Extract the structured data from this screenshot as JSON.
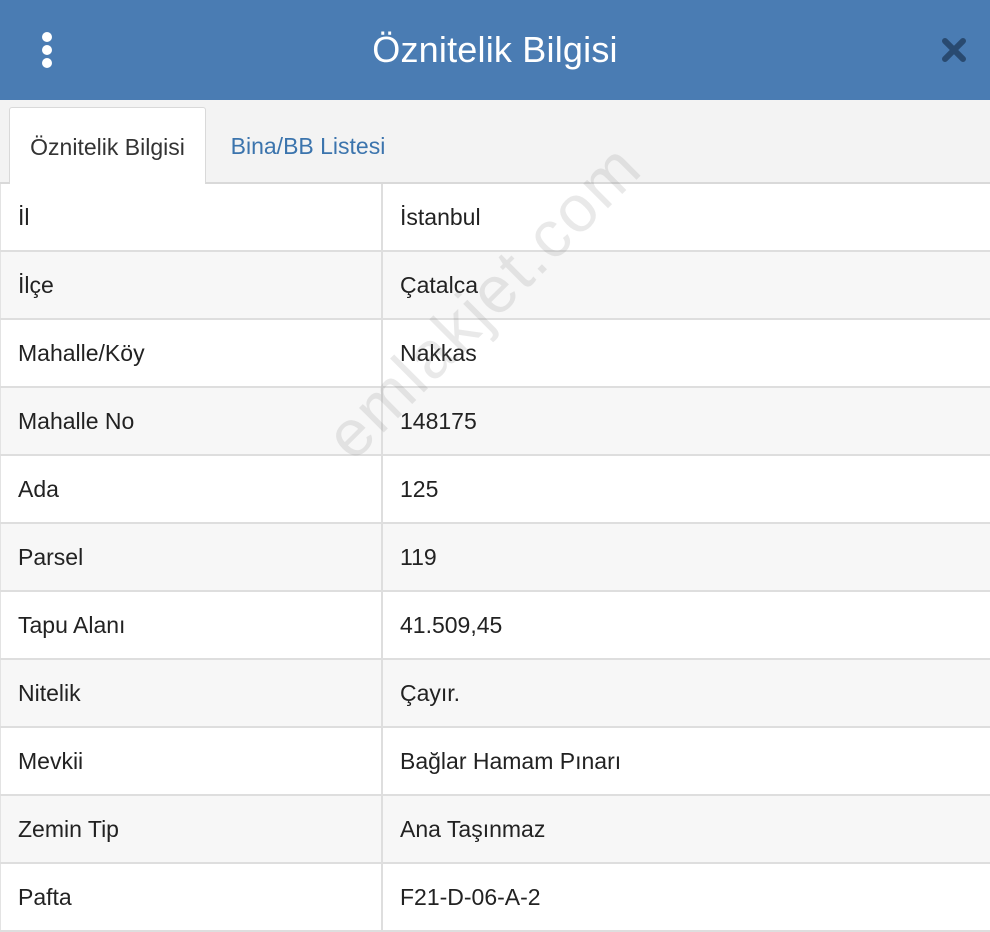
{
  "header": {
    "title": "Öznitelik Bilgisi",
    "menu_icon": "vertical-dots-icon",
    "close_icon": "close-icon"
  },
  "tabs": [
    {
      "label": "Öznitelik Bilgisi",
      "active": true
    },
    {
      "label": "Bina/BB Listesi",
      "active": false
    }
  ],
  "rows": [
    {
      "key": "İl",
      "value": "İstanbul"
    },
    {
      "key": "İlçe",
      "value": "Çatalca"
    },
    {
      "key": "Mahalle/Köy",
      "value": "Nakkas"
    },
    {
      "key": "Mahalle No",
      "value": "148175"
    },
    {
      "key": "Ada",
      "value": "125"
    },
    {
      "key": "Parsel",
      "value": "119"
    },
    {
      "key": "Tapu Alanı",
      "value": "41.509,45"
    },
    {
      "key": "Nitelik",
      "value": "Çayır."
    },
    {
      "key": "Mevkii",
      "value": "Bağlar Hamam Pınarı"
    },
    {
      "key": "Zemin Tip",
      "value": "Ana Taşınmaz"
    },
    {
      "key": "Pafta",
      "value": "F21-D-06-A-2"
    }
  ],
  "watermark": "emlakjet.com",
  "colors": {
    "header_bg": "#4a7cb3",
    "tab_link": "#3b74ad"
  }
}
